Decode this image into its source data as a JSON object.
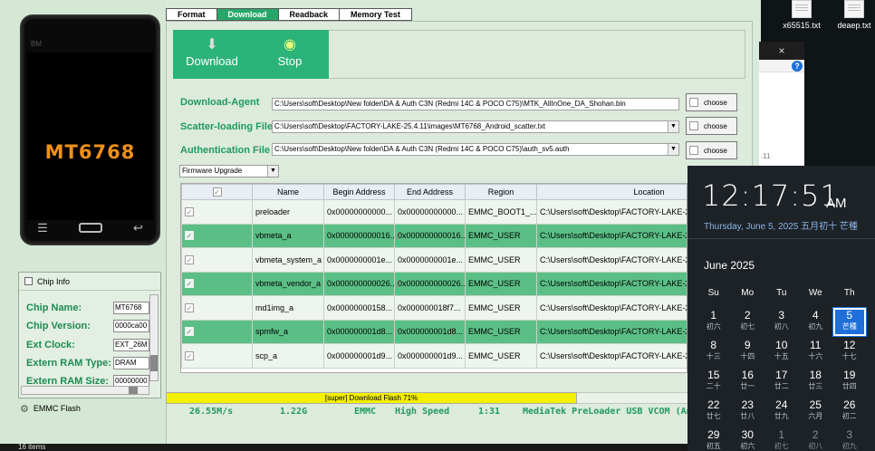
{
  "app": {
    "tabs": [
      "Format",
      "Download",
      "Readback",
      "Memory Test"
    ],
    "active_tab": "Download",
    "phone": {
      "chip_label": "MT6768",
      "brand_mark": "BM"
    },
    "chip_info": {
      "title": "Chip Info",
      "rows": [
        {
          "label": "Chip Name:",
          "value": "MT6768"
        },
        {
          "label": "Chip Version:",
          "value": "0000ca00"
        },
        {
          "label": "Ext Clock:",
          "value": "EXT_26M"
        },
        {
          "label": "Extern RAM Type:",
          "value": "DRAM"
        },
        {
          "label": "Extern RAM Size:",
          "value": "00000000"
        }
      ],
      "emmc_flash_label": "EMMC Flash"
    },
    "actions": {
      "download_label": "Download",
      "stop_label": "Stop"
    },
    "files": {
      "download_agent": {
        "label": "Download-Agent",
        "path": "C:\\Users\\soft\\Desktop\\New folder\\DA & Auth C3N (Redmi 14C & POCO C75)\\MTK_AllInOne_DA_Shohan.bin"
      },
      "scatter": {
        "label": "Scatter-loading File",
        "path": "C:\\Users\\soft\\Desktop\\FACTORY-LAKE-25.4.11\\images\\MT6768_Android_scatter.txt"
      },
      "auth": {
        "label": "Authentication File",
        "path": "C:\\Users\\soft\\Desktop\\New folder\\DA & Auth C3N (Redmi 14C & POCO C75)\\auth_sv5.auth"
      },
      "choose_label": "choose"
    },
    "mode": "Firmware Upgrade",
    "table": {
      "headers": [
        "",
        "Name",
        "Begin Address",
        "End Address",
        "Region",
        "Location"
      ],
      "rows": [
        {
          "name": "preloader",
          "begin": "0x00000000000...",
          "end": "0x00000000000...",
          "region": "EMMC_BOOT1_...",
          "location": "C:\\Users\\soft\\Desktop\\FACTORY-LAKE-2"
        },
        {
          "name": "vbmeta_a",
          "begin": "0x000000000016...",
          "end": "0x000000000016...",
          "region": "EMMC_USER",
          "location": "C:\\Users\\soft\\Desktop\\FACTORY-LAKE-2"
        },
        {
          "name": "vbmeta_system_a",
          "begin": "0x0000000001e...",
          "end": "0x0000000001e...",
          "region": "EMMC_USER",
          "location": "C:\\Users\\soft\\Desktop\\FACTORY-LAKE-2"
        },
        {
          "name": "vbmeta_vendor_a",
          "begin": "0x000000000026...",
          "end": "0x000000000026...",
          "region": "EMMC_USER",
          "location": "C:\\Users\\soft\\Desktop\\FACTORY-LAKE-2"
        },
        {
          "name": "md1img_a",
          "begin": "0x00000000158...",
          "end": "0x000000018f7...",
          "region": "EMMC_USER",
          "location": "C:\\Users\\soft\\Desktop\\FACTORY-LAKE-2"
        },
        {
          "name": "spmfw_a",
          "begin": "0x000000001d8...",
          "end": "0x000000001d8...",
          "region": "EMMC_USER",
          "location": "C:\\Users\\soft\\Desktop\\FACTORY-LAKE-2"
        },
        {
          "name": "scp_a",
          "begin": "0x000000001d9...",
          "end": "0x000000001d9...",
          "region": "EMMC_USER",
          "location": "C:\\Users\\soft\\Desktop\\FACTORY-LAKE-2"
        }
      ]
    },
    "progress": {
      "text": "[super] Download Flash 71%",
      "percent": 71
    },
    "status": {
      "speed": "26.55M/s",
      "size": "1.22G",
      "storage": "EMMC",
      "mode": "High Speed",
      "time": "1:31",
      "port": "MediaTek PreLoader USB VCOM (Andr"
    },
    "bottom_text": "16 items"
  },
  "desktop": {
    "files": [
      "x65515.txt",
      "deaep.txt"
    ]
  },
  "popup": {
    "close": "×",
    "help": "?",
    "fragment": ".11"
  },
  "clock": {
    "time": "12:17:51",
    "ampm": "AM",
    "date": "Thursday, June 5, 2025 五月初十 芒種",
    "month": "June 2025",
    "weekdays": [
      "Su",
      "Mo",
      "Tu",
      "We",
      "Th"
    ],
    "weeks": [
      [
        {
          "d": "1",
          "l": "初六"
        },
        {
          "d": "2",
          "l": "初七"
        },
        {
          "d": "3",
          "l": "初八"
        },
        {
          "d": "4",
          "l": "初九"
        },
        {
          "d": "5",
          "l": "芒種",
          "today": true
        }
      ],
      [
        {
          "d": "8",
          "l": "十三"
        },
        {
          "d": "9",
          "l": "十四"
        },
        {
          "d": "10",
          "l": "十五"
        },
        {
          "d": "11",
          "l": "十六"
        },
        {
          "d": "12",
          "l": "十七"
        }
      ],
      [
        {
          "d": "15",
          "l": "二十"
        },
        {
          "d": "16",
          "l": "廿一"
        },
        {
          "d": "17",
          "l": "廿二"
        },
        {
          "d": "18",
          "l": "廿三"
        },
        {
          "d": "19",
          "l": "廿四"
        }
      ],
      [
        {
          "d": "22",
          "l": "廿七"
        },
        {
          "d": "23",
          "l": "廿八"
        },
        {
          "d": "24",
          "l": "廿九"
        },
        {
          "d": "25",
          "l": "六月"
        },
        {
          "d": "26",
          "l": "初二"
        }
      ],
      [
        {
          "d": "29",
          "l": "初五"
        },
        {
          "d": "30",
          "l": "初六"
        },
        {
          "d": "1",
          "l": "初七",
          "dim": true
        },
        {
          "d": "2",
          "l": "初八",
          "dim": true
        },
        {
          "d": "3",
          "l": "初九",
          "dim": true
        }
      ]
    ]
  }
}
